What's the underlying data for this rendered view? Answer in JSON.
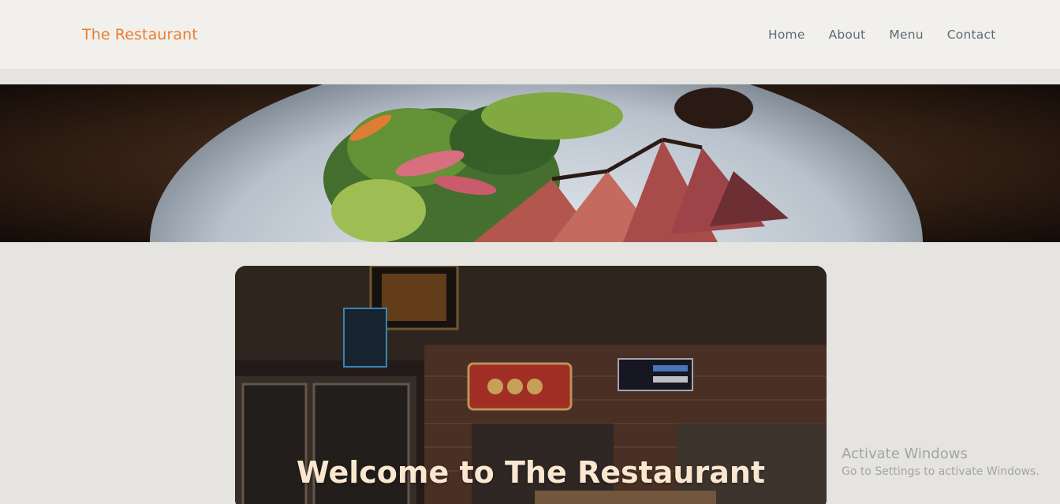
{
  "header": {
    "brand": "The Restaurant",
    "nav": [
      "Home",
      "About",
      "Menu",
      "Contact"
    ]
  },
  "hero_card": {
    "title": "Welcome to The Restaurant"
  },
  "watermark": {
    "line1": "Activate Windows",
    "line2": "Go to Settings to activate Windows."
  },
  "colors": {
    "brand": "#ea7d2c",
    "nav_text": "#5f6b73",
    "page_bg": "#e5e4e0",
    "header_bg": "#f1f0ed",
    "title_text": "#fbe7cf"
  },
  "images": {
    "banner": "salad-and-seared-tuna-plate-photo",
    "card": "asian-restaurant-interior-neon-signs-photo"
  }
}
